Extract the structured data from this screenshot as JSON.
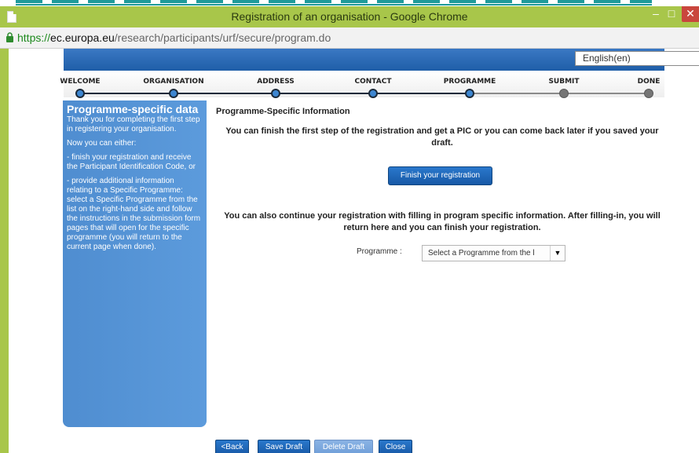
{
  "window": {
    "title": "Registration of an organisation - Google Chrome",
    "minimize": "–",
    "maximize": "□",
    "close": "✕"
  },
  "address": {
    "protocol": "https://",
    "host": "ec.europa.eu",
    "path": "/research/participants/urf/secure/program.do"
  },
  "header": {
    "language": "English(en)"
  },
  "steps": [
    {
      "label": "WELCOME",
      "status": "done"
    },
    {
      "label": "ORGANISATION",
      "status": "done"
    },
    {
      "label": "ADDRESS",
      "status": "done"
    },
    {
      "label": "CONTACT",
      "status": "done"
    },
    {
      "label": "PROGRAMME",
      "status": "done"
    },
    {
      "label": "SUBMIT",
      "status": "todo"
    },
    {
      "label": "DONE",
      "status": "todo"
    }
  ],
  "sidebar": {
    "title": "Programme-specific data",
    "p1": "Thank you for completing the first step in registering your organisation.",
    "p2": "Now you can either:",
    "p3": "- finish your registration and receive the Participant Identification Code, or",
    "p4": "- provide additional information relating to a Specific Programme: select a Specific Programme from the list on the right-hand side and follow the instructions in the submission form pages that will open for the specific programme (you will return to the current page when done)."
  },
  "main": {
    "title": "Programme-Specific Information",
    "text1": "You can finish the first step of the registration and get a PIC or you can come back later if you saved your draft.",
    "finish_button": "Finish your registration",
    "text2": "You can also continue your registration with filling in program specific information. After filling-in, you will return here and you can finish your registration.",
    "programme_label": "Programme :",
    "programme_select": "Select a Programme from the l"
  },
  "footer": {
    "back": "<Back",
    "save": "Save Draft",
    "delete": "Delete Draft",
    "close": "Close"
  },
  "colors": {
    "window_frame": "#a8c64a",
    "banner": "#2a6bb8",
    "sidebar": "#5593d6",
    "button": "#1f66b5",
    "button_disabled": "#7ea9de",
    "step_done": "#3d86d1",
    "step_todo": "#757575"
  }
}
